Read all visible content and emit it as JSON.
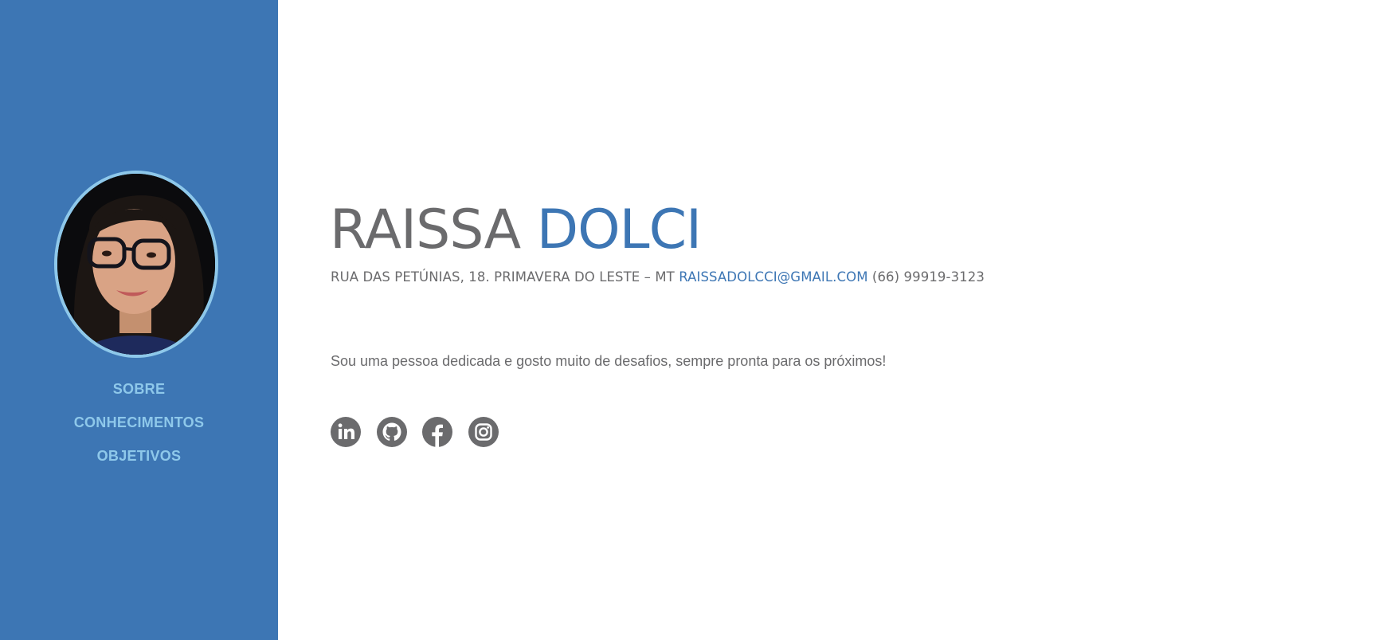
{
  "sidebar": {
    "nav": [
      {
        "label": "SOBRE"
      },
      {
        "label": "CONHECIMENTOS"
      },
      {
        "label": "OBJETIVOS"
      }
    ]
  },
  "profile": {
    "first_name": "RAISSA",
    "last_name": "DOLCI",
    "address": "RUA DAS PETÚNIAS, 18. PRIMAVERA DO LESTE – MT",
    "email": "RAISSADOLCCI@GMAIL.COM",
    "phone": "(66) 99919-3123",
    "about": "Sou uma pessoa dedicada e gosto muito de desafios, sempre pronta para os próximos!"
  },
  "socials": [
    {
      "icon": "linkedin-icon"
    },
    {
      "icon": "github-icon"
    },
    {
      "icon": "facebook-icon"
    },
    {
      "icon": "instagram-icon"
    }
  ],
  "colors": {
    "sidebar_bg": "#3d76b4",
    "accent": "#3d76b4",
    "nav_text": "#8ec8ea",
    "body_text": "#6b6b6d",
    "icon": "#6b6b6d"
  }
}
